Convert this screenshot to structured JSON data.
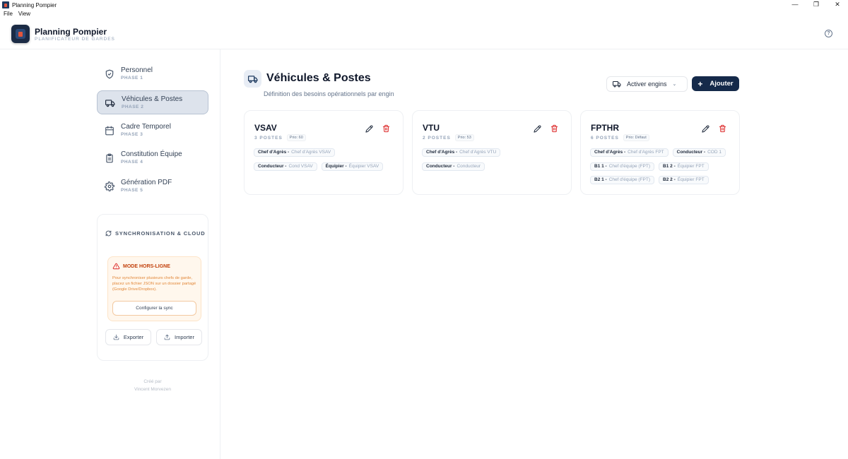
{
  "window": {
    "title": "Planning Pompier",
    "controls": [
      "—",
      "❐",
      "✕"
    ]
  },
  "menu": {
    "items": [
      "File",
      "View"
    ]
  },
  "header": {
    "title": "Planning Pompier",
    "subtitle": "PLANIFICATEUR DE GARDES"
  },
  "sidebar": {
    "items": [
      {
        "label": "Personnel",
        "phase": "PHASE 1",
        "icon": "shield-icon"
      },
      {
        "label": "Véhicules & Postes",
        "phase": "PHASE 2",
        "icon": "truck-icon",
        "active": true
      },
      {
        "label": "Cadre Temporel",
        "phase": "PHASE 3",
        "icon": "calendar-icon"
      },
      {
        "label": "Constitution Équipe",
        "phase": "PHASE 4",
        "icon": "clipboard-icon"
      },
      {
        "label": "Génération PDF",
        "phase": "PHASE 5",
        "icon": "gear-icon"
      }
    ],
    "sync": {
      "title": "SYNCHRONISATION & CLOUD",
      "offline_title": "MODE HORS-LIGNE",
      "offline_text": "Pour synchroniser plusieurs chefs de garde, placez un fichier JSON sur un dossier partagé (Google Drive/Dropbox).",
      "configure_label": "Configurer la sync",
      "export_label": "Exporter",
      "import_label": "Importer"
    },
    "credit": {
      "line1": "Créé par",
      "line2": "Vincent Morvezen"
    }
  },
  "main": {
    "title": "Véhicules & Postes",
    "subtitle": "Définition des besoins opérationnels par engin",
    "activate_label": "Activer engins",
    "add_label": "Ajouter",
    "vehicles": [
      {
        "name": "VSAV",
        "count": "3 POSTES",
        "prio": "Prio: 60",
        "postes": [
          {
            "role": "Chef d'Agrès -",
            "value": "Chef d'Agrès VSAV"
          },
          {
            "role": "Conducteur -",
            "value": "Cond VSAV"
          },
          {
            "role": "Équipier -",
            "value": "Équipier VSAV"
          }
        ]
      },
      {
        "name": "VTU",
        "count": "2 POSTES",
        "prio": "Prio: 53",
        "postes": [
          {
            "role": "Chef d'Agrès -",
            "value": "Chef d'Agrès VTU"
          },
          {
            "role": "Conducteur -",
            "value": "Conducteur"
          }
        ]
      },
      {
        "name": "FPTHR",
        "count": "6 POSTES",
        "prio": "Prio: Défaut",
        "postes": [
          {
            "role": "Chef d'Agrès -",
            "value": "Chef d'Agrès FPT"
          },
          {
            "role": "Conducteur -",
            "value": "COD 1"
          },
          {
            "role": "B1 1 -",
            "value": "Chef d'équipe (FPT)"
          },
          {
            "role": "B1 2 -",
            "value": "Équipier FPT"
          },
          {
            "role": "B2 1 -",
            "value": "Chef d'équipe (FPT)"
          },
          {
            "role": "B2 2 -",
            "value": "Équipier FPT"
          }
        ]
      }
    ]
  },
  "colors": {
    "accent": "#152a4a",
    "active_bg": "#dde3ec",
    "danger": "#dc2626",
    "warning": "#c2410c"
  }
}
